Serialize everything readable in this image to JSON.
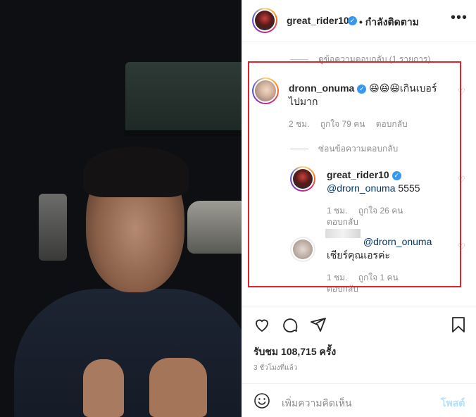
{
  "post": {
    "username": "great_rider10",
    "follow_status": "• กำลังติดตาม",
    "more": "•••"
  },
  "comments": {
    "prev_replies": "ดูข้อความตอบกลับ (1 รายการ)",
    "main": {
      "username": "dronn_onuma",
      "emoji": "😆😆😆",
      "text_line1": "เกินเบอร์",
      "text_line2": "ไปมาก",
      "time": "2 ชม.",
      "likes": "ถูกใจ 79 คน",
      "reply": "ตอบกลับ"
    },
    "hide_replies": "ซ่อนข้อความตอบกลับ",
    "reply1": {
      "username": "great_rider10",
      "mention": "@drorn_onuma",
      "text": " 5555",
      "time": "1 ชม.",
      "likes": "ถูกใจ 26 คน",
      "reply": "ตอบกลับ"
    },
    "reply2": {
      "mention": "@drorn_onuma",
      "text": "เชียร์คุณเอรค่ะ",
      "time": "1 ชม.",
      "likes": "ถูกใจ 1 คน",
      "reply": "ตอบกลับ"
    }
  },
  "actions": {
    "views": "รับชม 108,715 ครั้ง",
    "time_ago": "3 ชั่วโมงที่แล้ว"
  },
  "add_comment": {
    "placeholder": "เพิ่มความคิดเห็น",
    "post_label": "โพสต์"
  },
  "colors": {
    "highlight": "#e0242e",
    "verified": "#3897f0",
    "link": "#00376b"
  }
}
